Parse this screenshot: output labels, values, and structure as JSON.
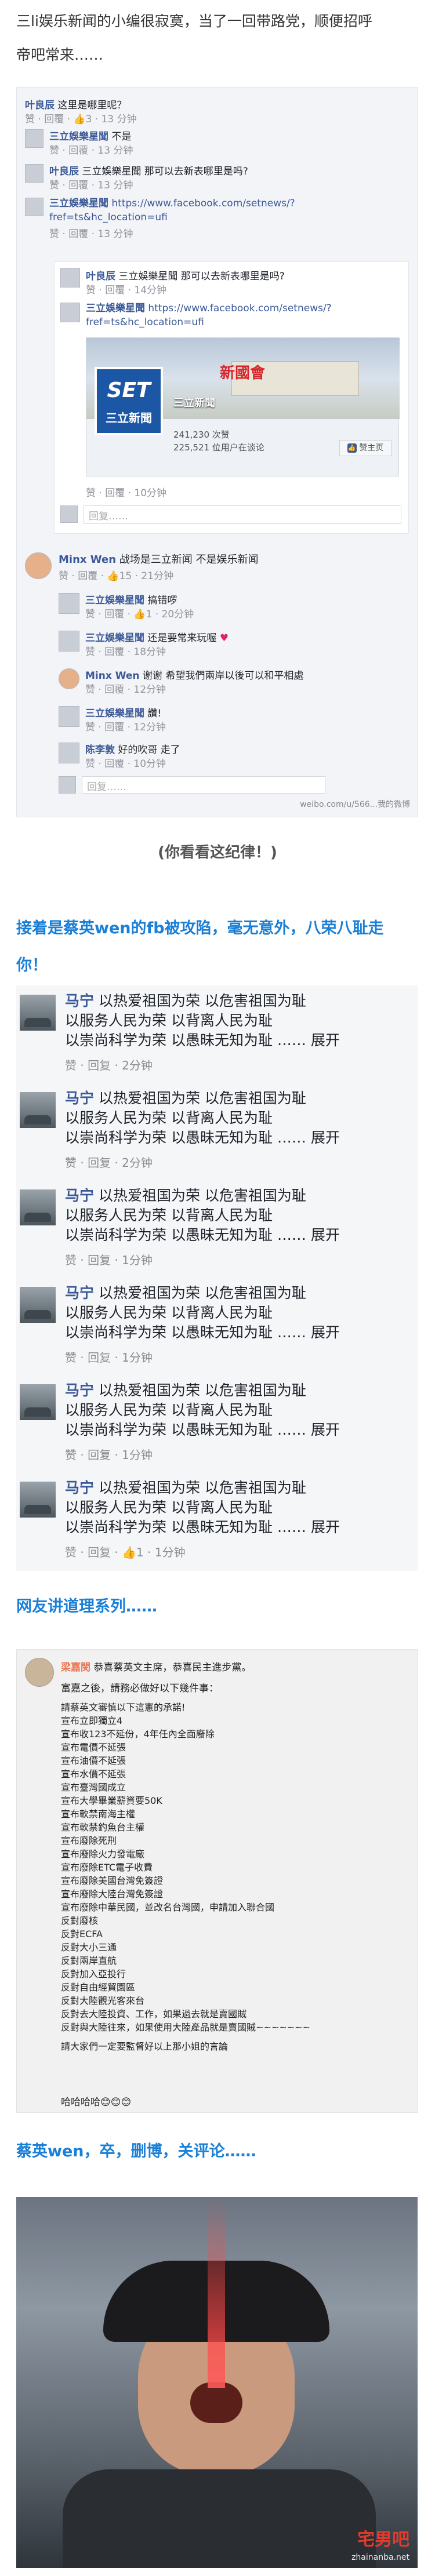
{
  "intro": {
    "line1": "三li娱乐新闻的小编很寂寞，当了一回带路党，顺便招呼",
    "line2": "帝吧常来……"
  },
  "card1": {
    "c1_name": "叶良辰",
    "c1_text": "这里是哪里呢？",
    "c1_meta": "赞 · 回覆 · 👍3 · 13 分钟",
    "c2_name": "三立娛樂星聞",
    "c2_text": "不是",
    "c2_meta": "赞 · 回覆 · 13 分钟",
    "c3_name": "叶良辰",
    "c3_text": "三立娛樂星聞 那可以去新表哪里是吗?",
    "c3_meta": "赞 · 回覆 · 13 分钟",
    "c4_name": "三立娛樂星聞",
    "c4_text": "https://www.facebook.com/setnews/?",
    "c4_text2": "fref=ts&hc_location=ufi",
    "c4_meta": "赞 · 回覆 · 13 分钟",
    "nested_name": "叶良辰",
    "nested_text": "三立娛樂星聞 那可以去新表哪里是吗?",
    "nested_meta": "赞 · 回覆 · 14分钟",
    "nested2_name": "三立娛樂星聞",
    "nested2_text": "https://www.facebook.com/setnews/?",
    "nested2_text2": "fref=ts&hc_location=ufi",
    "preview_logo_top": "SET",
    "preview_logo_bottom": "三立新聞",
    "preview_title": "三立新聞",
    "preview_banner": "新國會",
    "preview_likes1": "241,230 次赞",
    "preview_likes2": "225,521 位用户在谈论",
    "preview_button": "赞主页",
    "nested2_meta": "赞 · 回覆 · 10分钟",
    "reply_placeholder": "回复……",
    "c5_name": "Minx Wen",
    "c5_text": "战场是三立新闻 不是娱乐新闻",
    "c5_meta": "赞 · 回覆 · 👍15 · 21分钟",
    "r1_name": "三立娛樂星聞",
    "r1_text": "搞错啰",
    "r1_meta": "赞 · 回覆 · 👍1 · 20分钟",
    "r2_name": "三立娛樂星聞",
    "r2_text": "还是要常来玩喔",
    "r2_meta": "赞 · 回覆 · 18分钟",
    "r3_name": "Minx Wen",
    "r3_text": "谢谢 希望我們兩岸以後可以和平相處",
    "r3_meta": "赞 · 回覆 · 12分钟",
    "r4_name": "三立娛樂星聞",
    "r4_text": "讚!",
    "r4_meta": "赞 · 回覆 · 12分钟",
    "r5_name": "陈李敦",
    "r5_text": "好的吹哥 走了",
    "r5_meta": "赞 · 回覆 · 10分钟",
    "reply_placeholder2": "回复……",
    "watermark": "weibo.com/u/566...我的微博"
  },
  "caption1": "(你看看这纪律！)",
  "section2": {
    "line1": "接着是蔡英wen的fb被攻陷，毫无意外，八荣八耻走",
    "line2": "你！"
  },
  "spam": {
    "name": "马宁",
    "l1": "以热爱祖国为荣 以危害祖国为耻",
    "l2": "以服务人民为荣 以背离人民为耻",
    "l3": "以崇尚科学为荣 以愚昧无知为耻 …… 展开",
    "items": [
      {
        "meta": "赞 · 回复 · 2分钟"
      },
      {
        "meta": "赞 · 回复 · 2分钟"
      },
      {
        "meta": "赞 · 回复 · 1分钟"
      },
      {
        "meta": "赞 · 回复 · 1分钟"
      },
      {
        "meta": "赞 · 回复 · 1分钟"
      },
      {
        "meta": "赞 · 回复 · 👍1 · 1分钟"
      }
    ]
  },
  "section3": "网友讲道理系列……",
  "weibo": {
    "user": "梁嘉閔",
    "header_text": "恭喜蔡英文主席，恭喜民主進步黨。",
    "greeting": "富嘉之後，請務必做好以下幾件事：",
    "items": [
      "請蔡英文審慎以下這憲的承諾!",
      "宣布立即獨立4",
      "宣布收123不延份，4年任內全面廢除",
      "宣布電價不延張",
      "宣布油價不延張",
      "宣布水價不延張",
      "宣布臺灣國成立",
      "宣布大學畢業薪資要50K",
      "宣布軟禁南海主權",
      "宣布軟禁釣魚台主權",
      "宣布廢除死刑",
      "宣布廢除火力發電廠",
      "宣布廢除ETC電子收費",
      "宣布廢除美國台灣免簽證",
      "宣布廢除大陸台灣免簽證",
      "宣布廢除中華民國，並改名台灣國，申請加入聯合國",
      "反對廢核",
      "反對ECFA",
      "反對大小三通",
      "反對兩岸直航",
      "反對加入亞投行",
      "反對自由經貿園區",
      "反對大陸觀光客來台",
      "反對去大陸投資、工作，如果過去就是賣國賊",
      "反對與大陸往來，如果使用大陸產品就是賣國賊~~~~~~~",
      "請大家們一定要監督好以上那小姐的言論"
    ],
    "sign_off": "哈哈哈哈😊😊😊"
  },
  "section4": "蔡英wen，卒，删博，关评论……",
  "footer_watermark": "宅男吧",
  "footer_url": "zhainanba.net"
}
